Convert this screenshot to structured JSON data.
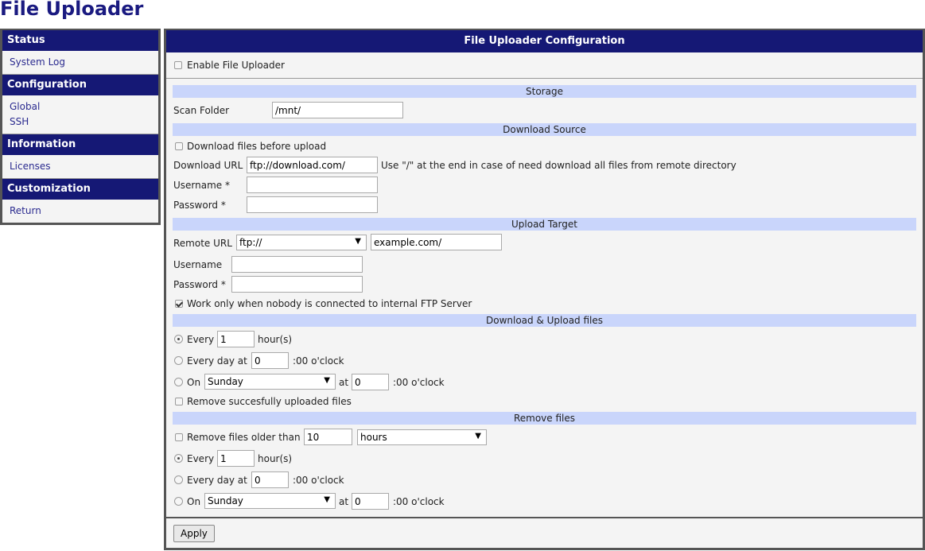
{
  "title": "File Uploader",
  "sidebar": {
    "sections": [
      {
        "title": "Status",
        "items": [
          "System Log"
        ]
      },
      {
        "title": "Configuration",
        "items": [
          "Global",
          "SSH"
        ]
      },
      {
        "title": "Information",
        "items": [
          "Licenses"
        ]
      },
      {
        "title": "Customization",
        "items": [
          "Return"
        ]
      }
    ]
  },
  "main": {
    "header": "File Uploader Configuration",
    "enable_label": "Enable File Uploader",
    "storage": {
      "section": "Storage",
      "scan_folder_label": "Scan Folder",
      "scan_folder_value": "/mnt/"
    },
    "download": {
      "section": "Download Source",
      "before_upload_label": "Download files before upload",
      "url_label": "Download URL",
      "url_value": "ftp://download.com/",
      "url_hint": "Use \"/\" at the end in case of need download all files from remote directory",
      "username_label": "Username *",
      "password_label": "Password *"
    },
    "upload": {
      "section": "Upload Target",
      "remote_url_label": "Remote URL",
      "protocol_value": "ftp://",
      "host_value": "example.com/",
      "username_label": "Username",
      "password_label": "Password *",
      "ftp_only_label": "Work only when nobody is connected to internal FTP Server"
    },
    "schedule": {
      "section": "Download & Upload files",
      "every_label": "Every",
      "every_value": "1",
      "hours_label": "hour(s)",
      "every_day_label": "Every day at",
      "every_day_value": "0",
      "oclock_label": ":00 o'clock",
      "on_label": "On",
      "day_value": "Sunday",
      "at_label": "at",
      "at_value": "0",
      "remove_uploaded_label": "Remove succesfully uploaded files"
    },
    "remove": {
      "section": "Remove files",
      "older_label": "Remove files older than",
      "older_value": "10",
      "unit_value": "hours",
      "every_label": "Every",
      "every_value": "1",
      "hours_label": "hour(s)",
      "every_day_label": "Every day at",
      "every_day_value": "0",
      "oclock_label": ":00 o'clock",
      "on_label": "On",
      "day_value": "Sunday",
      "at_label": "at",
      "at_value": "0"
    },
    "apply_label": "Apply"
  }
}
